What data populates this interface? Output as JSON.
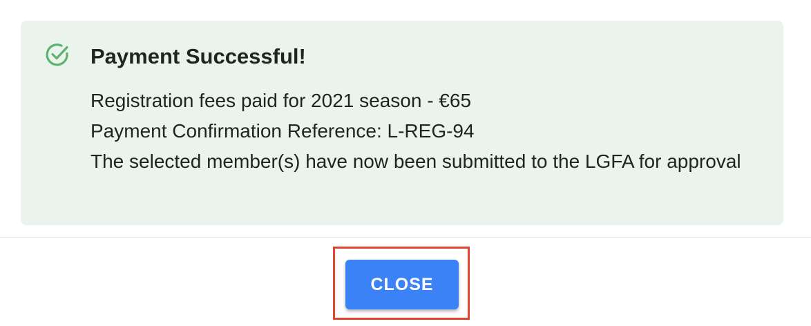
{
  "alert": {
    "icon": "check-circle-icon",
    "title": "Payment Successful!",
    "lines": [
      "Registration fees paid for 2021 season - €65",
      "Payment Confirmation Reference: L-REG-94",
      "The selected member(s) have now been submitted to the LGFA for approval"
    ]
  },
  "footer": {
    "close_label": "CLOSE"
  },
  "colors": {
    "alert_background": "#eaf4ec",
    "success_icon": "#5cb270",
    "button": "#3b82f6",
    "highlight_border": "#e0442f"
  }
}
